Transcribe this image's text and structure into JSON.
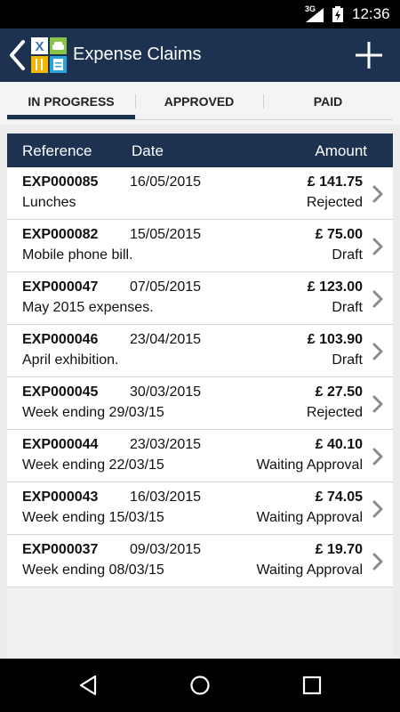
{
  "status_bar": {
    "network": "3G",
    "time": "12:36"
  },
  "app_bar": {
    "title": "Expense Claims",
    "icons": [
      "back-arrow-icon",
      "app-logo-icon",
      "add-icon"
    ]
  },
  "tabs": [
    {
      "label": "IN PROGRESS",
      "selected": true
    },
    {
      "label": "APPROVED",
      "selected": false
    },
    {
      "label": "PAID",
      "selected": false
    }
  ],
  "table": {
    "headers": {
      "reference": "Reference",
      "date": "Date",
      "amount": "Amount"
    },
    "rows": [
      {
        "reference": "EXP000085",
        "date": "16/05/2015",
        "description": "Lunches",
        "amount": "£ 141.75",
        "status": "Rejected"
      },
      {
        "reference": "EXP000082",
        "date": "15/05/2015",
        "description": "Mobile phone bill.",
        "amount": "£ 75.00",
        "status": "Draft"
      },
      {
        "reference": "EXP000047",
        "date": "07/05/2015",
        "description": "May 2015 expenses.",
        "amount": "£ 123.00",
        "status": "Draft"
      },
      {
        "reference": "EXP000046",
        "date": "23/04/2015",
        "description": "April exhibition.",
        "amount": "£ 103.90",
        "status": "Draft"
      },
      {
        "reference": "EXP000045",
        "date": "30/03/2015",
        "description": "Week ending 29/03/15",
        "amount": "£ 27.50",
        "status": "Rejected"
      },
      {
        "reference": "EXP000044",
        "date": "23/03/2015",
        "description": "Week ending 22/03/15",
        "amount": "£ 40.10",
        "status": "Waiting Approval"
      },
      {
        "reference": "EXP000043",
        "date": "16/03/2015",
        "description": "Week ending 15/03/15",
        "amount": "£ 74.05",
        "status": "Waiting Approval"
      },
      {
        "reference": "EXP000037",
        "date": "09/03/2015",
        "description": "Week ending 08/03/15",
        "amount": "£ 19.70",
        "status": "Waiting Approval"
      }
    ]
  },
  "nav_bar": {
    "icons": [
      "back-triangle-icon",
      "home-circle-icon",
      "recents-square-icon"
    ]
  },
  "colors": {
    "app_bar": "#1d3150",
    "table_header": "#1d3150",
    "background": "#ececec"
  }
}
